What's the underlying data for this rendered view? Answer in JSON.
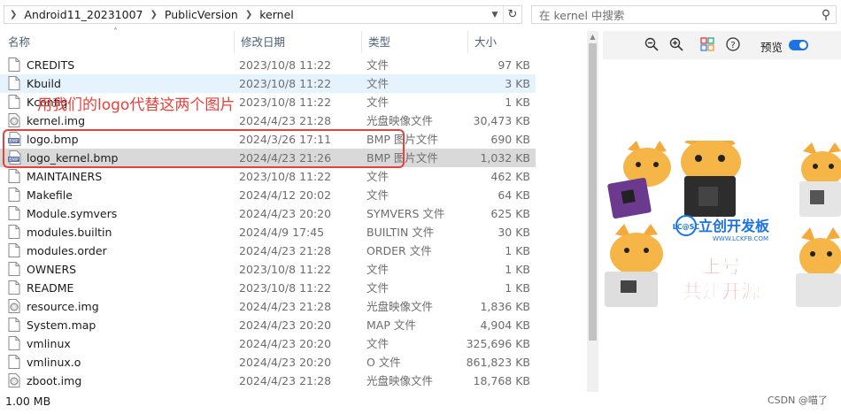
{
  "address": {
    "crumbs": [
      "Android11_20231007",
      "PublicVersion",
      "kernel"
    ],
    "search_placeholder": "在 kernel 中搜索"
  },
  "columns": {
    "name": "名称",
    "date": "修改日期",
    "type": "类型",
    "size": "大小"
  },
  "files": [
    {
      "name": "CREDITS",
      "date": "2023/10/8 11:22",
      "type": "文件",
      "size": "97 KB",
      "icon": "file-icon"
    },
    {
      "name": "Kbuild",
      "date": "2023/10/8 11:22",
      "type": "文件",
      "size": "3 KB",
      "icon": "file-icon"
    },
    {
      "name": "Kconfig",
      "date": "2023/10/8 11:22",
      "type": "文件",
      "size": "1 KB",
      "icon": "file-icon"
    },
    {
      "name": "kernel.img",
      "date": "2024/4/23 21:28",
      "type": "光盘映像文件",
      "size": "30,473 KB",
      "icon": "disc-image-icon"
    },
    {
      "name": "logo.bmp",
      "date": "2024/3/26 17:11",
      "type": "BMP 图片文件",
      "size": "690 KB",
      "icon": "bmp-icon"
    },
    {
      "name": "logo_kernel.bmp",
      "date": "2024/4/23 21:26",
      "type": "BMP 图片文件",
      "size": "1,032 KB",
      "icon": "bmp-icon"
    },
    {
      "name": "MAINTAINERS",
      "date": "2023/10/8 11:22",
      "type": "文件",
      "size": "462 KB",
      "icon": "file-icon"
    },
    {
      "name": "Makefile",
      "date": "2024/4/12 20:02",
      "type": "文件",
      "size": "64 KB",
      "icon": "file-icon"
    },
    {
      "name": "Module.symvers",
      "date": "2024/4/23 20:20",
      "type": "SYMVERS 文件",
      "size": "625 KB",
      "icon": "file-icon"
    },
    {
      "name": "modules.builtin",
      "date": "2024/4/9 17:45",
      "type": "BUILTIN 文件",
      "size": "30 KB",
      "icon": "file-icon"
    },
    {
      "name": "modules.order",
      "date": "2024/4/23 21:28",
      "type": "ORDER 文件",
      "size": "1 KB",
      "icon": "file-icon"
    },
    {
      "name": "OWNERS",
      "date": "2023/10/8 11:22",
      "type": "文件",
      "size": "1 KB",
      "icon": "file-icon"
    },
    {
      "name": "README",
      "date": "2023/10/8 11:22",
      "type": "文件",
      "size": "1 KB",
      "icon": "file-icon"
    },
    {
      "name": "resource.img",
      "date": "2024/4/23 21:28",
      "type": "光盘映像文件",
      "size": "1,836 KB",
      "icon": "disc-image-icon"
    },
    {
      "name": "System.map",
      "date": "2024/4/23 20:20",
      "type": "MAP 文件",
      "size": "4,904 KB",
      "icon": "file-icon"
    },
    {
      "name": "vmlinux",
      "date": "2024/4/23 20:20",
      "type": "文件",
      "size": "325,696 KB",
      "icon": "file-icon"
    },
    {
      "name": "vmlinux.o",
      "date": "2024/4/23 20:20",
      "type": "O 文件",
      "size": "861,823 KB",
      "icon": "file-icon"
    },
    {
      "name": "zboot.img",
      "date": "2024/4/23 21:28",
      "type": "光盘映像文件",
      "size": "18,768 KB",
      "icon": "disc-image-icon"
    }
  ],
  "annotation": "用我们的logo代替这两个图片",
  "status": "1.00 MB",
  "preview": {
    "label": "预览",
    "brand_title": "立创开发板",
    "brand_url": "WWW.LCKFB.COM",
    "slogan_line1": "上号",
    "slogan_line2": "共建开源",
    "logo_text": "LC@SC"
  },
  "watermark": "CSDN @喵了",
  "colors": {
    "accent": "#1a73e8",
    "annotation": "#e8403a",
    "selected_light": "#e5f3ff",
    "selected_gray": "#d9d9d9"
  }
}
